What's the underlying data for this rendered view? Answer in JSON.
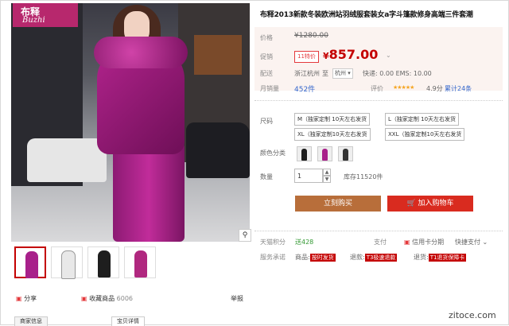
{
  "brand": {
    "logo_cn": "布释",
    "logo_en": "Buzhi"
  },
  "product": {
    "title": "布释2013新款冬装欧洲站羽绒服套装女a字斗篷款修身高端三件套潮"
  },
  "price": {
    "label": "价格",
    "original": "¥1280.00",
    "promo_label": "促销",
    "promo_tag": "11特价",
    "current": "857.00",
    "currency": "¥"
  },
  "shipping": {
    "label": "配送",
    "from": "浙江杭州",
    "to": "至",
    "city": "杭州",
    "shipping_text": "快递: 0.00 EMS: 10.00"
  },
  "stats": {
    "sales_label": "月销量",
    "sales": "452件",
    "rating_label": "评价",
    "rating": "4.9分",
    "reviews": "累计24条"
  },
  "sizes": {
    "label": "尺码",
    "options": [
      "M（独家定制 10天左右发货",
      "L（独家定制 10天左右发货",
      "XL（独家定制10天左右发货",
      "XXL（独家定制10天左右发货"
    ]
  },
  "color": {
    "label": "颜色分类"
  },
  "quantity": {
    "label": "数量",
    "value": "1",
    "stock": "库存11520件"
  },
  "actions": {
    "buy_now": "立刻购买",
    "add_cart": "加入购物车"
  },
  "services": {
    "points_label": "天猫积分",
    "points": "送428",
    "pay_label": "支付",
    "credit": "信用卡分期",
    "express_pay": "快捷支付",
    "promise_label": "服务承诺",
    "item1_prefix": "商品:",
    "item1_tag": "按时发货",
    "item2_prefix": "退款:",
    "item2_tag": "T3极速退款",
    "item3_prefix": "退货:",
    "item3_tag": "T1退货保障卡"
  },
  "share": {
    "share_label": "分享",
    "fav_label": "收藏商品",
    "fav_count": "6006",
    "report": "举报"
  },
  "tabs": [
    "商家信息",
    "宝贝详情"
  ],
  "watermark": "zitoce.com"
}
